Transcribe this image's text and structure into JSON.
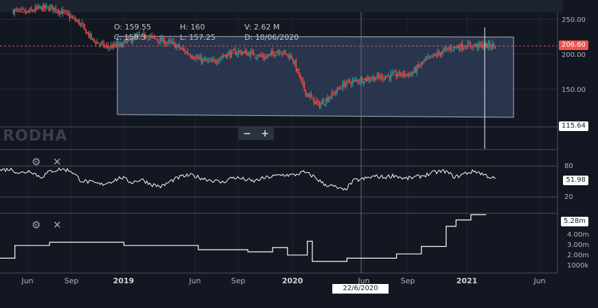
{
  "chart_data": [
    {
      "type": "candlestick",
      "x_start": "2018-04",
      "x_end": "2021-03",
      "y_ticks": [
        150,
        200,
        250
      ],
      "price_labels": [
        "250.00",
        "200.00",
        "150.00"
      ],
      "current_price": "206.60",
      "lower_channel_level": "115.64",
      "ohlc": {
        "open_label": "O:",
        "open": "159.55",
        "high_label": "H:",
        "high": "160",
        "low_label": "L:",
        "low": "157.25",
        "close_label": "C:",
        "close": "158.3",
        "volume_label": "V:",
        "volume": "2.62 M",
        "date_label": "D:",
        "date": "10/06/2020"
      },
      "close_path": [
        [
          "2018-05",
          258
        ],
        [
          "2018-06",
          255
        ],
        [
          "2018-07",
          262
        ],
        [
          "2018-08",
          262
        ],
        [
          "2018-09",
          253
        ],
        [
          "2018-10",
          240
        ],
        [
          "2018-11",
          215
        ],
        [
          "2018-12",
          205
        ],
        [
          "2019-01",
          207
        ],
        [
          "2019-02",
          218
        ],
        [
          "2019-03",
          222
        ],
        [
          "2019-04",
          215
        ],
        [
          "2019-05",
          210
        ],
        [
          "2019-06",
          198
        ],
        [
          "2019-07",
          187
        ],
        [
          "2019-08",
          183
        ],
        [
          "2019-09",
          194
        ],
        [
          "2019-10",
          198
        ],
        [
          "2019-11",
          195
        ],
        [
          "2019-12",
          190
        ],
        [
          "2020-01",
          200
        ],
        [
          "2020-02",
          190
        ],
        [
          "2020-03",
          140
        ],
        [
          "2020-04",
          120
        ],
        [
          "2020-05",
          135
        ],
        [
          "2020-06",
          152
        ],
        [
          "2020-07",
          157
        ],
        [
          "2020-08",
          160
        ],
        [
          "2020-09",
          162
        ],
        [
          "2020-10",
          165
        ],
        [
          "2020-11",
          166
        ],
        [
          "2020-12",
          185
        ],
        [
          "2021-01",
          195
        ],
        [
          "2021-02",
          204
        ],
        [
          "2021-03",
          207
        ]
      ]
    },
    {
      "type": "line",
      "name": "oscillator",
      "y_ticks": [
        20,
        80
      ],
      "last_value": "51.98",
      "values": [
        72,
        74,
        66,
        71,
        58,
        70,
        74,
        71,
        52,
        48,
        44,
        50,
        58,
        48,
        54,
        44,
        40,
        52,
        60,
        62,
        56,
        52,
        48,
        58,
        55,
        50,
        56,
        60,
        63,
        62,
        68,
        60,
        45,
        40,
        32,
        52,
        55,
        60,
        58,
        62,
        55,
        58,
        62,
        68,
        70,
        58,
        66,
        70,
        62,
        54
      ]
    },
    {
      "type": "line",
      "name": "volume",
      "y_tick_labels": [
        "4.00m",
        "3.00m",
        "2.00m",
        "1000k"
      ],
      "last_value": "5.28m",
      "values": [
        [
          0,
          1.2
        ],
        [
          0.03,
          2.4
        ],
        [
          0.1,
          2.7
        ],
        [
          0.25,
          2.4
        ],
        [
          0.4,
          2.0
        ],
        [
          0.5,
          1.8
        ],
        [
          0.55,
          2.2
        ],
        [
          0.58,
          1.5
        ],
        [
          0.62,
          2.8
        ],
        [
          0.63,
          0.9
        ],
        [
          0.7,
          1.2
        ],
        [
          0.8,
          1.6
        ],
        [
          0.85,
          2.3
        ],
        [
          0.9,
          4.2
        ],
        [
          0.92,
          4.8
        ],
        [
          0.95,
          5.3
        ],
        [
          0.98,
          5.28
        ]
      ]
    }
  ],
  "x_axis_labels": [
    "Jun",
    "Sep",
    "2019",
    "Jun",
    "Sep",
    "2020",
    "Jun",
    "Sep",
    "2021",
    "Jun"
  ],
  "cursor_date": "22/6/2020",
  "watermark": "RODHA",
  "pane_controls": {
    "settings_icon": "gear-icon",
    "close_icon": "close-icon"
  },
  "zoom_buttons": {
    "minus": "−",
    "plus": "+"
  },
  "colors": {
    "up": "#26a69a",
    "down": "#ef5350",
    "ma": "#e53935",
    "price_tag": "#ef5350",
    "channel_fill": "#2e3a55"
  }
}
